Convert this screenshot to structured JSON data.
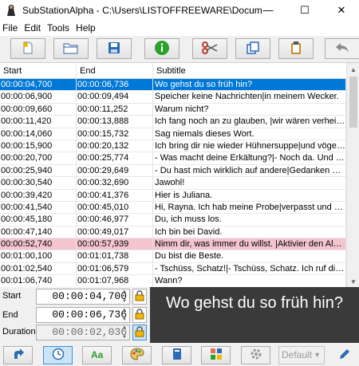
{
  "window": {
    "title": "SubStationAlpha - C:\\Users\\LISTOFFREEWARE\\Docume...",
    "minimize": "—",
    "maximize": "☐",
    "close": "✕"
  },
  "menu": [
    "File",
    "Edit",
    "Tools",
    "Help"
  ],
  "toolbar": [
    "new-file-icon",
    "open-folder-icon",
    "save-icon",
    "info-icon",
    "cut-icon",
    "copy-icon",
    "paste-icon",
    "undo-icon"
  ],
  "columns": {
    "start": "Start",
    "end": "End",
    "subtitle": "Subtitle"
  },
  "rows": [
    {
      "start": "00:00:04,700",
      "end": "00:00:06,736",
      "subtitle": "Wo gehst du so früh hin?",
      "state": "selected"
    },
    {
      "start": "00:00:06,900",
      "end": "00:00:09,494",
      "subtitle": "Speicher keine Nachrichten|in meinem Wecker."
    },
    {
      "start": "00:00:09,660",
      "end": "00:00:11,252",
      "subtitle": "Warum nicht?"
    },
    {
      "start": "00:00:11,420",
      "end": "00:00:13,888",
      "subtitle": "Ich fang noch an zu glauben, |wir wären verheira..."
    },
    {
      "start": "00:00:14,060",
      "end": "00:00:15,732",
      "subtitle": "Sag niemals dieses Wort."
    },
    {
      "start": "00:00:15,900",
      "end": "00:00:20,132",
      "subtitle": "Ich bring dir nie wieder Hühnersuppe|und vögel d..."
    },
    {
      "start": "00:00:20,700",
      "end": "00:00:25,774",
      "subtitle": "- Was macht deine Erkältung?|- Noch da. Und dei..."
    },
    {
      "start": "00:00:25,940",
      "end": "00:00:29,649",
      "subtitle": "- Du hast mich wirklich auf andere|Gedanken geb..."
    },
    {
      "start": "00:00:30,540",
      "end": "00:00:32,690",
      "subtitle": "Jawohl!"
    },
    {
      "start": "00:00:39,420",
      "end": "00:00:41,376",
      "subtitle": "Hier is Juliana."
    },
    {
      "start": "00:00:41,540",
      "end": "00:00:45,010",
      "subtitle": "Hi, Rayna. Ich hab meine Probe|verpasst und me..."
    },
    {
      "start": "00:00:45,180",
      "end": "00:00:46,977",
      "subtitle": "Du, ich muss los."
    },
    {
      "start": "00:00:47,140",
      "end": "00:00:49,017",
      "subtitle": "Ich bin bei David."
    },
    {
      "start": "00:00:52,740",
      "end": "00:00:57,939",
      "subtitle": "Nimm dir, was immer du willst. |Aktivier den Alarm...",
      "state": "pink"
    },
    {
      "start": "00:01:00,100",
      "end": "00:01:01,738",
      "subtitle": "Du bist die Beste."
    },
    {
      "start": "00:01:02,540",
      "end": "00:01:06,579",
      "subtitle": "- Tschüss, Schatz!|- Tschüss, Schatz. Ich ruf dic..."
    },
    {
      "start": "00:01:06,740",
      "end": "00:01:07,968",
      "subtitle": "Wann?"
    }
  ],
  "editor": {
    "start_label": "Start",
    "start_value": "00:00:04,700",
    "end_label": "End",
    "end_value": "00:00:06,736",
    "duration_label": "Duration",
    "duration_value": "00:00:02,036",
    "preview_text": "Wo gehst du so früh hin?"
  },
  "bottombar": {
    "icons": [
      "jump-icon",
      "clock-icon",
      "font-icon",
      "palette-icon",
      "import-icon",
      "grid-icon",
      "settings-icon",
      "edit-icon"
    ],
    "style_select": "Default"
  },
  "colors": {
    "selection": "#0078d7",
    "highlight": "#f4c4cf",
    "preview_bg": "#3a3a3a"
  }
}
